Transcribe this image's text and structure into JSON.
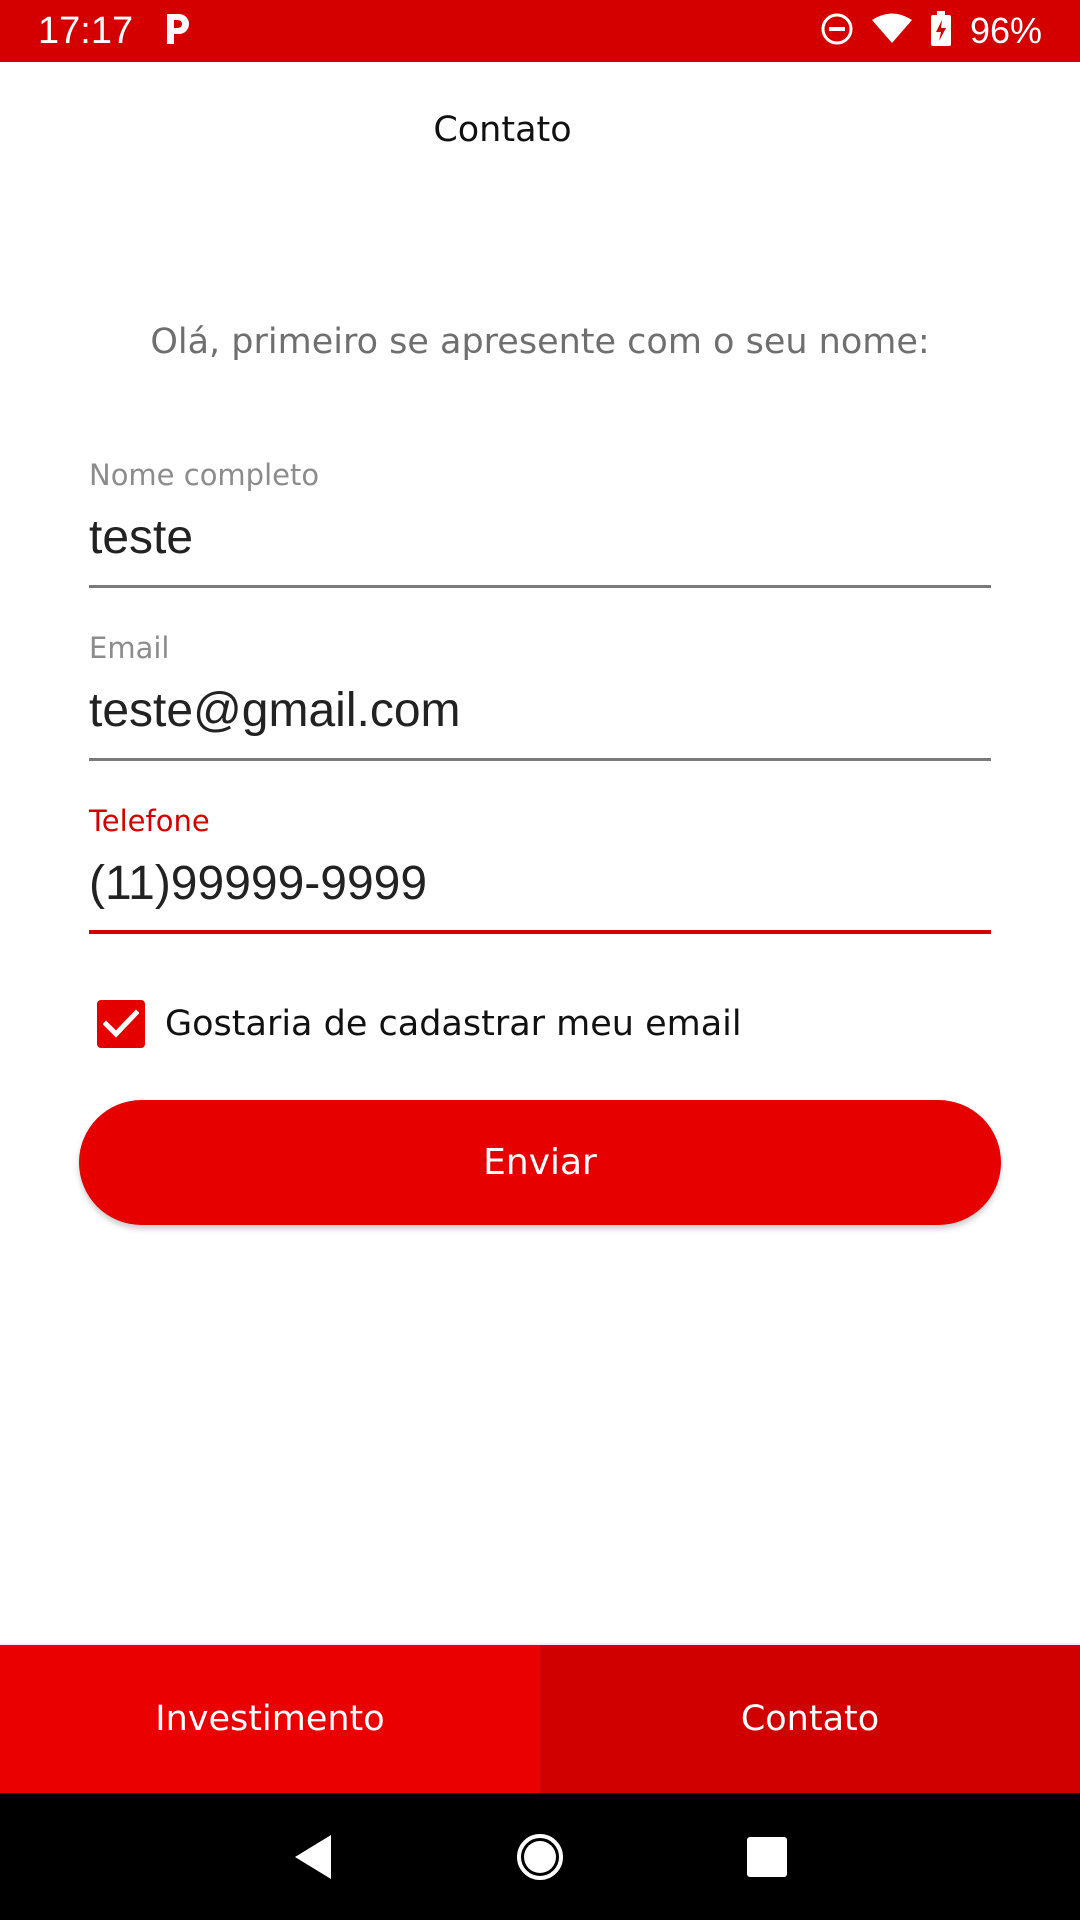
{
  "status_bar": {
    "time": "17:17",
    "battery": "96%",
    "icons": [
      "parking-icon",
      "do-not-disturb-icon",
      "wifi-icon",
      "battery-charging-icon"
    ]
  },
  "header": {
    "title": "Contato"
  },
  "intro": "Olá, primeiro se apresente com o seu nome:",
  "form": {
    "name": {
      "label": "Nome completo",
      "value": "teste"
    },
    "email": {
      "label": "Email",
      "value": "teste@gmail.com"
    },
    "phone": {
      "label": "Telefone",
      "value": "(11)99999-9999"
    },
    "subscribe": {
      "label": "Gostaria de cadastrar meu email",
      "checked": true
    },
    "submit_label": "Enviar"
  },
  "bottom_nav": {
    "tabs": [
      {
        "label": "Investimento",
        "active": false
      },
      {
        "label": "Contato",
        "active": true
      }
    ]
  },
  "colors": {
    "primary": "#e60000",
    "status_bar": "#d40000",
    "active_tab": "#d10000"
  }
}
